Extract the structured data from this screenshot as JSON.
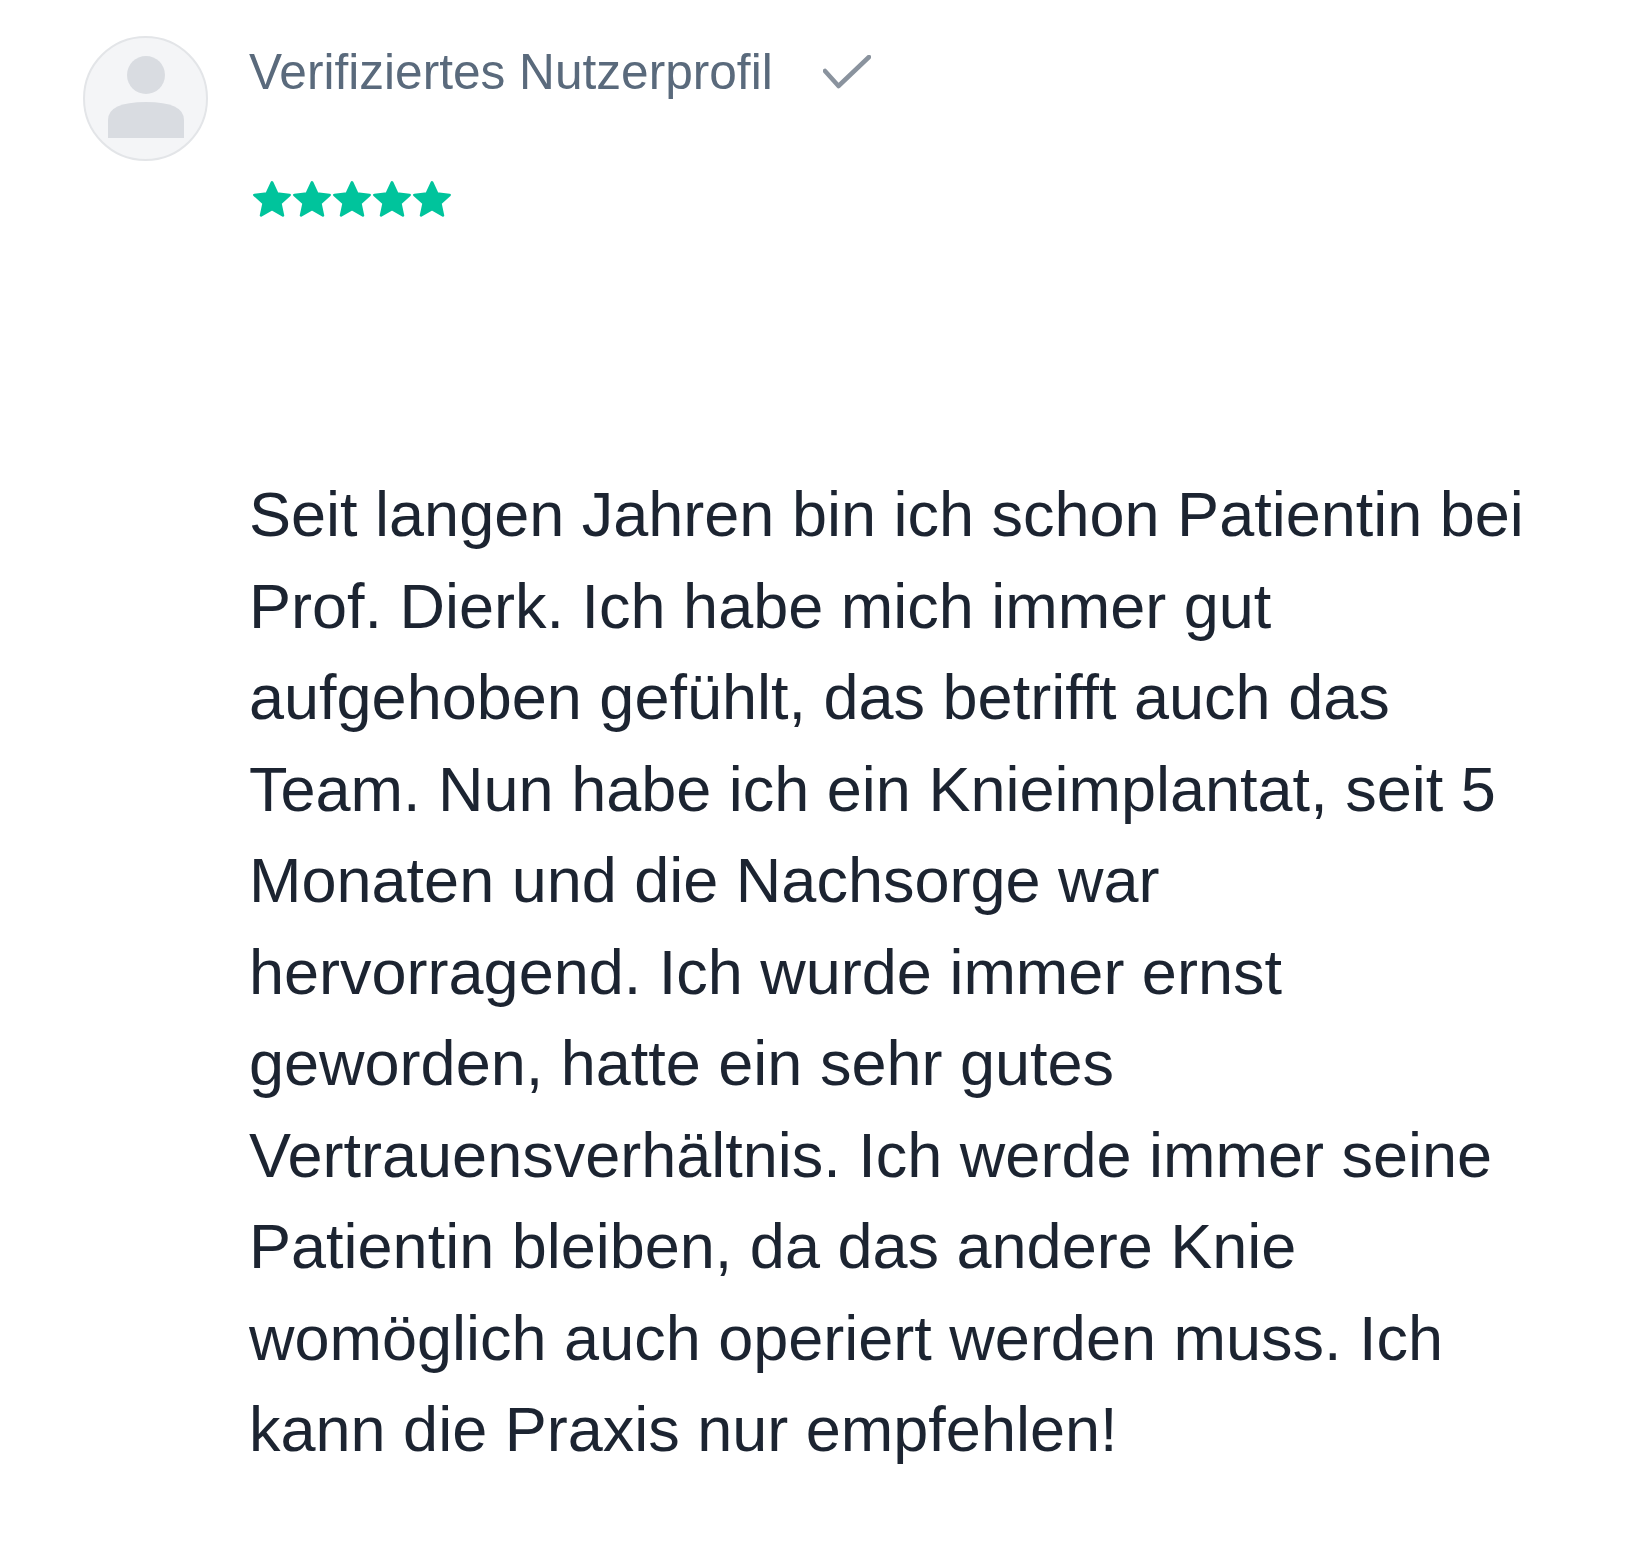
{
  "reviewer": {
    "label": "Verifiziertes Nutzerprofil",
    "verified": true
  },
  "review": {
    "stars": 5,
    "text": "Seit langen Jahren bin ich schon Patientin bei Prof. Dierk. Ich habe mich immer gut aufgehoben gefühlt, das betrifft auch das Team. Nun habe ich ein Knieimplantat, seit 5 Monaten und die Nachsorge war hervorragend. Ich wurde immer ernst geworden, hatte ein sehr gutes Vertrauensverhältnis. Ich werde immer seine Patientin bleiben, da das andere Knie womöglich auch operiert werden muss. Ich kann die Praxis nur empfehlen!"
  }
}
